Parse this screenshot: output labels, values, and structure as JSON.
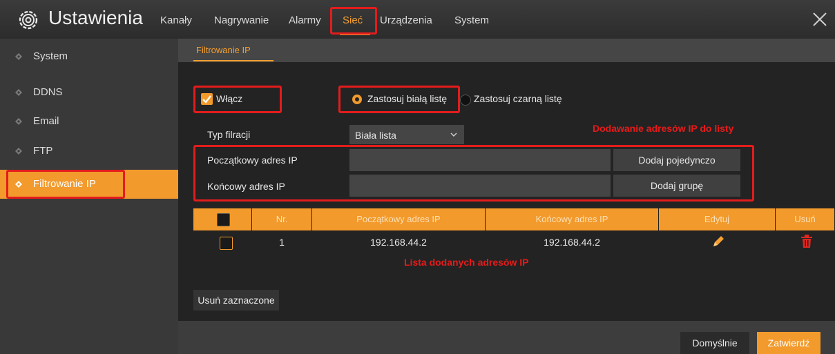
{
  "header": {
    "title": "Ustawienia",
    "tabs": [
      "Kanały",
      "Nagrywanie",
      "Alarmy",
      "Sieć",
      "Urządzenia",
      "System"
    ],
    "active_tab": "Sieć"
  },
  "sidebar": {
    "items": [
      {
        "label": "System"
      },
      {
        "label": "DDNS"
      },
      {
        "label": "Email"
      },
      {
        "label": "FTP"
      },
      {
        "label": "Filtrowanie IP"
      }
    ],
    "active": "Filtrowanie IP"
  },
  "subtab": "Filtrowanie IP",
  "form": {
    "enable_label": "Włącz",
    "enable_checked": true,
    "radio_white": "Zastosuj białą listę",
    "radio_black": "Zastosuj czarną listę",
    "filter_type_label": "Typ filracji",
    "filter_type_value": "Biała lista",
    "start_ip_label": "Początkowy adres IP",
    "end_ip_label": "Końcowy adres IP",
    "start_ip_value": "",
    "end_ip_value": "",
    "add_single": "Dodaj pojedynczo",
    "add_group": "Dodaj grupę"
  },
  "annotations": {
    "add_ips": "Dodawanie adresów IP do listy",
    "list_ips": "Lista dodanych adresów IP"
  },
  "table": {
    "headers": [
      "Nr.",
      "Początkowy adres IP",
      "Końcowy adres IP",
      "Edytuj",
      "Usuń"
    ],
    "rows": [
      {
        "nr": "1",
        "start": "192.168.44.2",
        "end": "192.168.44.2"
      }
    ]
  },
  "delete_selected": "Usuń zaznaczone",
  "footer": {
    "default_btn": "Domyślnie",
    "confirm_btn": "Zatwierdź"
  },
  "colors": {
    "accent": "#f29a2b",
    "highlight_box": "#e41c1c"
  }
}
